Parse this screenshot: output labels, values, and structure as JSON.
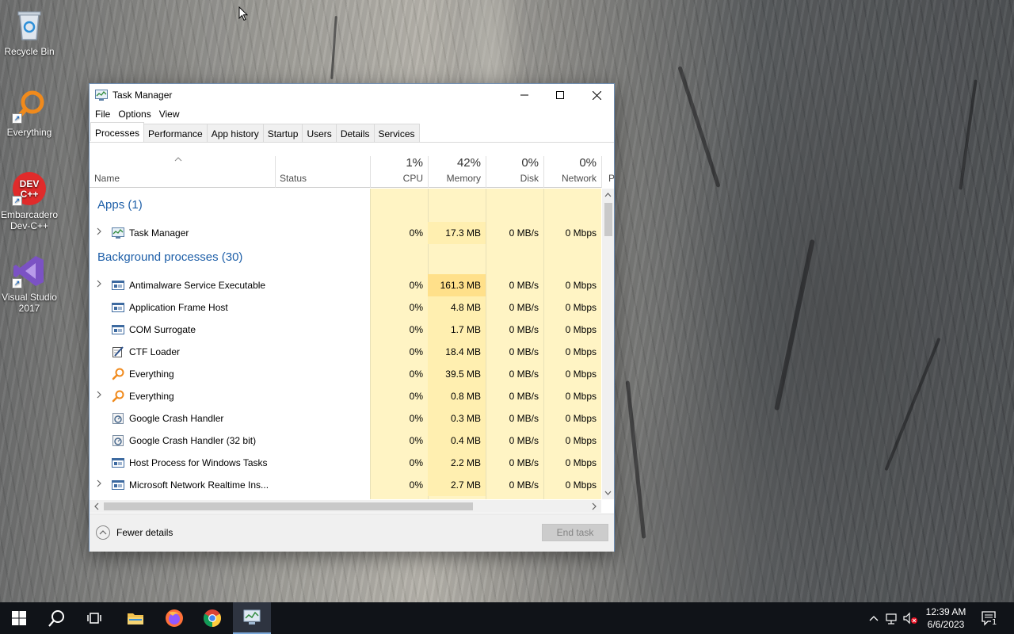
{
  "desktop": {
    "icons": [
      {
        "label": "Recycle Bin",
        "icon": "recycle-bin-icon"
      },
      {
        "label": "Everything",
        "icon": "everything-icon"
      },
      {
        "label": "Embarcadero Dev-C++",
        "icon": "devcpp-icon",
        "icon_text": "DEV C++"
      },
      {
        "label": "Visual Studio 2017",
        "icon": "visual-studio-icon"
      }
    ]
  },
  "window": {
    "title": "Task Manager",
    "menu": [
      "File",
      "Options",
      "View"
    ],
    "tabs": [
      "Processes",
      "Performance",
      "App history",
      "Startup",
      "Users",
      "Details",
      "Services"
    ],
    "active_tab": "Processes"
  },
  "columns": {
    "name": "Name",
    "status": "Status",
    "cpu": {
      "pct": "1%",
      "label": "CPU"
    },
    "memory": {
      "pct": "42%",
      "label": "Memory"
    },
    "disk": {
      "pct": "0%",
      "label": "Disk"
    },
    "network": {
      "pct": "0%",
      "label": "Network"
    },
    "power_partial": "P"
  },
  "groups": {
    "apps": "Apps (1)",
    "background": "Background processes (30)"
  },
  "apps": [
    {
      "name": "Task Manager",
      "cpu": "0%",
      "memory": "17.3 MB",
      "disk": "0 MB/s",
      "network": "0 Mbps",
      "expandable": true,
      "icon": "task-manager-icon"
    }
  ],
  "background": [
    {
      "name": "Antimalware Service Executable",
      "cpu": "0%",
      "memory": "161.3 MB",
      "disk": "0 MB/s",
      "network": "0 Mbps",
      "expandable": true,
      "icon": "service-window-icon"
    },
    {
      "name": "Application Frame Host",
      "cpu": "0%",
      "memory": "4.8 MB",
      "disk": "0 MB/s",
      "network": "0 Mbps",
      "expandable": false,
      "icon": "service-window-icon"
    },
    {
      "name": "COM Surrogate",
      "cpu": "0%",
      "memory": "1.7 MB",
      "disk": "0 MB/s",
      "network": "0 Mbps",
      "expandable": false,
      "icon": "service-window-icon"
    },
    {
      "name": "CTF Loader",
      "cpu": "0%",
      "memory": "18.4 MB",
      "disk": "0 MB/s",
      "network": "0 Mbps",
      "expandable": false,
      "icon": "ctf-loader-icon"
    },
    {
      "name": "Everything",
      "cpu": "0%",
      "memory": "39.5 MB",
      "disk": "0 MB/s",
      "network": "0 Mbps",
      "expandable": false,
      "icon": "everything-icon"
    },
    {
      "name": "Everything",
      "cpu": "0%",
      "memory": "0.8 MB",
      "disk": "0 MB/s",
      "network": "0 Mbps",
      "expandable": true,
      "icon": "everything-icon"
    },
    {
      "name": "Google Crash Handler",
      "cpu": "0%",
      "memory": "0.3 MB",
      "disk": "0 MB/s",
      "network": "0 Mbps",
      "expandable": false,
      "icon": "crash-handler-icon"
    },
    {
      "name": "Google Crash Handler (32 bit)",
      "cpu": "0%",
      "memory": "0.4 MB",
      "disk": "0 MB/s",
      "network": "0 Mbps",
      "expandable": false,
      "icon": "crash-handler-icon"
    },
    {
      "name": "Host Process for Windows Tasks",
      "cpu": "0%",
      "memory": "2.2 MB",
      "disk": "0 MB/s",
      "network": "0 Mbps",
      "expandable": false,
      "icon": "service-window-icon"
    },
    {
      "name": "Microsoft Network Realtime Ins...",
      "cpu": "0%",
      "memory": "2.7 MB",
      "disk": "0 MB/s",
      "network": "0 Mbps",
      "expandable": true,
      "icon": "service-window-icon"
    }
  ],
  "footer": {
    "fewer_details": "Fewer details",
    "end_task": "End task"
  },
  "taskbar": {
    "clock_time": "12:39 AM",
    "clock_date": "6/6/2023",
    "notification_count": "1"
  },
  "colors": {
    "heat_light": "#fff4c4",
    "heat_mem": "#ffefb0",
    "heat_mem_high": "#ffe08a",
    "group_title": "#1e5fa8",
    "taskbar": "#101318"
  }
}
